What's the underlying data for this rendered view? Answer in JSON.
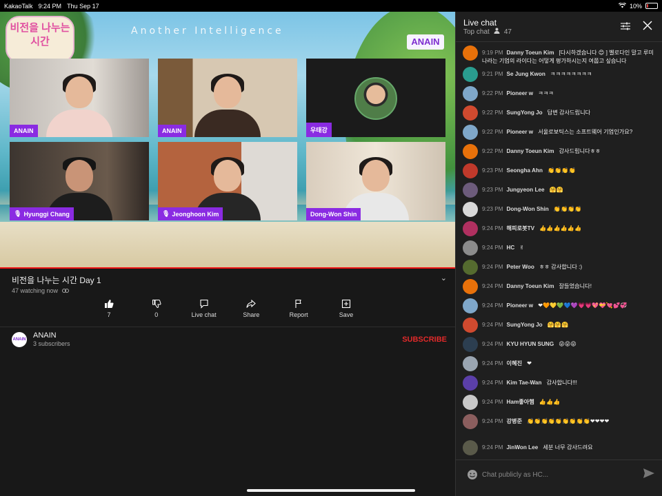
{
  "status_bar": {
    "app": "KakaoTalk",
    "time": "9:24 PM",
    "date": "Thu Sep 17",
    "battery": "10%"
  },
  "video": {
    "logo_text": "비전을 나누는 시간",
    "brand_title": "Another Intelligence",
    "brand_logo": "ANAIN",
    "tiles": [
      {
        "label": "ANAIN"
      },
      {
        "label": "ANAIN"
      },
      {
        "label": "우태강"
      },
      {
        "label": "Hyunggi Chang"
      },
      {
        "label": "Jeonghoon Kim"
      },
      {
        "label": "Dong-Won Shin"
      }
    ]
  },
  "info": {
    "title": "비전을 나누는 시간 Day 1",
    "watching": "47 watching now",
    "actions": [
      {
        "label": "7",
        "icon": "thumbs-up-icon"
      },
      {
        "label": "0",
        "icon": "thumbs-down-icon"
      },
      {
        "label": "Live chat",
        "icon": "live-chat-icon"
      },
      {
        "label": "Share",
        "icon": "share-icon"
      },
      {
        "label": "Report",
        "icon": "flag-icon"
      },
      {
        "label": "Save",
        "icon": "save-icon"
      }
    ],
    "channel": {
      "name": "ANAIN",
      "avatar_text": "ANAIN",
      "subscribers": "3 subscribers",
      "subscribe_label": "SUBSCRIBE"
    }
  },
  "chat": {
    "title": "Live chat",
    "mode": "Top chat",
    "viewer_count": "47",
    "input_placeholder": "Chat publicly as HC...",
    "messages": [
      {
        "time": "9:19 PM",
        "author": "Danny Toeun Kim",
        "text": "[다시하겠습니다 😊 ] 벨로다인 말고 루미나라는 기업의 라이다는 어떻게 평가하시는지 여쭙고 싶습니다",
        "color": "#e8710a"
      },
      {
        "time": "9:21 PM",
        "author": "Se Jung Kwon",
        "text": "ㅋㅋㅋㅋㅋㅋㅋㅋ",
        "color": "#2a9d8f"
      },
      {
        "time": "9:22 PM",
        "author": "Pioneer w",
        "text": "ㅋㅋㅋ",
        "color": "#7fa7c9"
      },
      {
        "time": "9:22 PM",
        "author": "SungYong Jo",
        "text": "답변 감사드립니다",
        "color": "#d04a2f"
      },
      {
        "time": "9:22 PM",
        "author": "Pioneer w",
        "text": "서울로보틱스는 소프트웨어 기업인가요?",
        "color": "#7fa7c9"
      },
      {
        "time": "9:22 PM",
        "author": "Danny Toeun Kim",
        "text": "감사드립니다ㅎㅎ",
        "color": "#e8710a"
      },
      {
        "time": "9:23 PM",
        "author": "Seongha Ahn",
        "text": "👏👏👏👏",
        "color": "#c0392b"
      },
      {
        "time": "9:23 PM",
        "author": "Jungyeon Lee",
        "text": "🤗🤗",
        "color": "#6c5b7b"
      },
      {
        "time": "9:23 PM",
        "author": "Dong-Won Shin",
        "text": "👏👏👏👏",
        "color": "#d8d8d8"
      },
      {
        "time": "9:24 PM",
        "author": "해피로봇TV",
        "text": "👍👍👍👍👍👍",
        "color": "#b03060"
      },
      {
        "time": "9:24 PM",
        "author": "HC",
        "text": "✌",
        "color": "#8c8c8c"
      },
      {
        "time": "9:24 PM",
        "author": "Peter Woo",
        "text": "ㅎㅎ 감사합니다 :)",
        "color": "#556b2f"
      },
      {
        "time": "9:24 PM",
        "author": "Danny Toeun Kim",
        "text": "잘들었습니다!",
        "color": "#e8710a"
      },
      {
        "time": "9:24 PM",
        "author": "Pioneer w",
        "text": "❤🧡💛💚💙💜💗💗💖💝💘💕💞",
        "color": "#7fa7c9"
      },
      {
        "time": "9:24 PM",
        "author": "SungYong Jo",
        "text": "🤗🤗🤗",
        "color": "#d04a2f"
      },
      {
        "time": "9:24 PM",
        "author": "KYU HYUN SUNG",
        "text": "😜😜😜",
        "color": "#2c3e50"
      },
      {
        "time": "9:24 PM",
        "author": "이혜진",
        "text": "❤",
        "color": "#9aa5b1"
      },
      {
        "time": "9:24 PM",
        "author": "Kim Tae-Wan",
        "text": "감사합니다!!!",
        "color": "#5b3fa8"
      },
      {
        "time": "9:24 PM",
        "author": "Ham좋아햄",
        "text": "👍👍👍",
        "color": "#c8c8c8"
      },
      {
        "time": "9:24 PM",
        "author": "강병준",
        "text": "👏👏👏👏👏👏👏👏👏❤❤❤❤",
        "color": "#8b5e5e"
      },
      {
        "time": "9:24 PM",
        "author": "JinWon Lee",
        "text": "세분 너무 감사드려요",
        "color": "#5a5a4a"
      }
    ]
  }
}
